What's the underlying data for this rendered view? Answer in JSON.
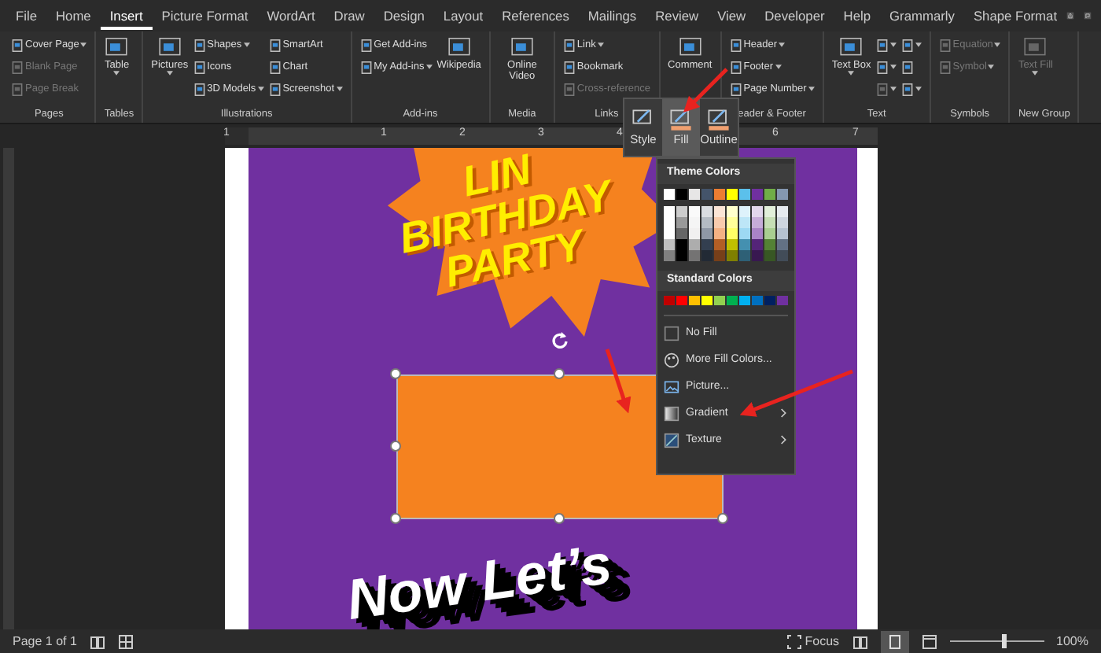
{
  "tabs": [
    {
      "label": "File",
      "selected": false
    },
    {
      "label": "Home",
      "selected": false
    },
    {
      "label": "Insert",
      "selected": true
    },
    {
      "label": "Picture Format",
      "selected": false
    },
    {
      "label": "WordArt",
      "selected": false
    },
    {
      "label": "Draw",
      "selected": false
    },
    {
      "label": "Design",
      "selected": false
    },
    {
      "label": "Layout",
      "selected": false
    },
    {
      "label": "References",
      "selected": false
    },
    {
      "label": "Mailings",
      "selected": false
    },
    {
      "label": "Review",
      "selected": false
    },
    {
      "label": "View",
      "selected": false
    },
    {
      "label": "Developer",
      "selected": false
    },
    {
      "label": "Help",
      "selected": false
    },
    {
      "label": "Grammarly",
      "selected": false
    },
    {
      "label": "Shape Format",
      "selected": false
    }
  ],
  "ribbon_groups": [
    {
      "label": "Pages",
      "items": [
        {
          "label": "Cover Page",
          "kind": "small",
          "dropdown": true,
          "disabled": false
        },
        {
          "label": "Blank Page",
          "kind": "small",
          "dropdown": false,
          "disabled": true
        },
        {
          "label": "Page Break",
          "kind": "small",
          "dropdown": false,
          "disabled": true
        }
      ]
    },
    {
      "label": "Tables",
      "items": [
        {
          "label": "Table",
          "kind": "large",
          "dropdown": true,
          "disabled": false
        }
      ]
    },
    {
      "label": "Illustrations",
      "items": [
        {
          "label": "Pictures",
          "kind": "large",
          "dropdown": true,
          "disabled": false
        },
        {
          "label": "Shapes",
          "kind": "small",
          "dropdown": true,
          "disabled": false
        },
        {
          "label": "Icons",
          "kind": "small",
          "dropdown": false,
          "disabled": false
        },
        {
          "label": "3D Models",
          "kind": "small",
          "dropdown": true,
          "disabled": false
        },
        {
          "label": "SmartArt",
          "kind": "small",
          "dropdown": false,
          "disabled": false
        },
        {
          "label": "Chart",
          "kind": "small",
          "dropdown": false,
          "disabled": false
        },
        {
          "label": "Screenshot",
          "kind": "small",
          "dropdown": true,
          "disabled": false
        }
      ]
    },
    {
      "label": "Add-ins",
      "items": [
        {
          "label": "Get Add-ins",
          "kind": "small",
          "dropdown": false,
          "disabled": false
        },
        {
          "label": "My Add-ins",
          "kind": "small",
          "dropdown": true,
          "disabled": false
        },
        {
          "label": "Wikipedia",
          "kind": "large",
          "dropdown": false,
          "disabled": false
        }
      ]
    },
    {
      "label": "Media",
      "items": [
        {
          "label": "Online Video",
          "kind": "large",
          "dropdown": false,
          "disabled": false
        }
      ]
    },
    {
      "label": "Links",
      "items": [
        {
          "label": "Link",
          "kind": "small",
          "dropdown": true,
          "disabled": false
        },
        {
          "label": "Bookmark",
          "kind": "small",
          "dropdown": false,
          "disabled": false
        },
        {
          "label": "Cross-reference",
          "kind": "small",
          "dropdown": false,
          "disabled": true
        }
      ]
    },
    {
      "items": [
        {
          "label": "Comment",
          "kind": "large",
          "dropdown": false,
          "disabled": false
        }
      ]
    },
    {
      "label": "eader & Footer",
      "items": [
        {
          "label": "Header",
          "kind": "small",
          "dropdown": true,
          "disabled": false
        },
        {
          "label": "Footer",
          "kind": "small",
          "dropdown": true,
          "disabled": false
        },
        {
          "label": "Page Number",
          "kind": "small",
          "dropdown": true,
          "disabled": false
        }
      ]
    },
    {
      "label": "Text",
      "items": [
        {
          "label": "Text Box",
          "kind": "large",
          "dropdown": true,
          "disabled": false
        },
        {
          "kind": "icon",
          "dropdown": true,
          "disabled": false
        },
        {
          "kind": "icon",
          "dropdown": true,
          "disabled": false
        },
        {
          "kind": "icon",
          "dropdown": true,
          "disabled": true
        },
        {
          "kind": "icon",
          "dropdown": true,
          "disabled": false
        },
        {
          "kind": "icon",
          "dropdown": false,
          "disabled": false
        },
        {
          "kind": "icon",
          "dropdown": true,
          "disabled": false
        }
      ]
    },
    {
      "label": "Symbols",
      "items": [
        {
          "label": "Equation",
          "kind": "small",
          "dropdown": true,
          "disabled": true
        },
        {
          "label": "Symbol",
          "kind": "small",
          "dropdown": true,
          "disabled": true
        }
      ]
    },
    {
      "label": "New Group",
      "items": [
        {
          "label": "Text Fill",
          "kind": "large",
          "dropdown": true,
          "disabled": true
        }
      ]
    }
  ],
  "ruler": [
    "1",
    "1",
    "2",
    "3",
    "4",
    "6",
    "7"
  ],
  "mini_toolbar": [
    {
      "label": "Style",
      "selected": false
    },
    {
      "label": "Fill",
      "selected": true
    },
    {
      "label": "Outline",
      "selected": false
    }
  ],
  "fill_menu": {
    "theme_title": "Theme Colors",
    "theme_colors": [
      {
        "color": "#ffffff"
      },
      {
        "color": "#000000"
      },
      {
        "color": "#e7e6e6"
      },
      {
        "color": "#44546a"
      },
      {
        "color": "#ed7d31"
      },
      {
        "color": "#ffff00"
      },
      {
        "color": "#5bc0eb"
      },
      {
        "color": "#7030a0"
      },
      {
        "color": "#70ad47"
      },
      {
        "color": "#8497b0"
      }
    ],
    "standard_title": "Standard Colors",
    "standard_colors": [
      {
        "color": "#c00000"
      },
      {
        "color": "#ff0000"
      },
      {
        "color": "#ffc000"
      },
      {
        "color": "#ffff00"
      },
      {
        "color": "#92d050"
      },
      {
        "color": "#00b050"
      },
      {
        "color": "#00b0f0"
      },
      {
        "color": "#0070c0"
      },
      {
        "color": "#002060"
      },
      {
        "color": "#7030a0"
      }
    ],
    "items": [
      {
        "label": "No Fill",
        "kind": "none",
        "submenu": false
      },
      {
        "label": "More Fill Colors...",
        "kind": "palette",
        "submenu": false
      },
      {
        "label": "Picture...",
        "kind": "picture",
        "submenu": false
      },
      {
        "label": "Gradient",
        "kind": "gradient",
        "submenu": true
      },
      {
        "label": "Texture",
        "kind": "texture",
        "submenu": true
      }
    ]
  },
  "poster": {
    "headline": [
      "LIN",
      "BIRTHDAY",
      "PARTY"
    ],
    "subline": "Now Let’s"
  },
  "status_bar": {
    "page": "Page 1 of 1",
    "focus": "Focus",
    "zoom": "100%",
    "zoom_slider": {
      "level": 0.55
    }
  }
}
